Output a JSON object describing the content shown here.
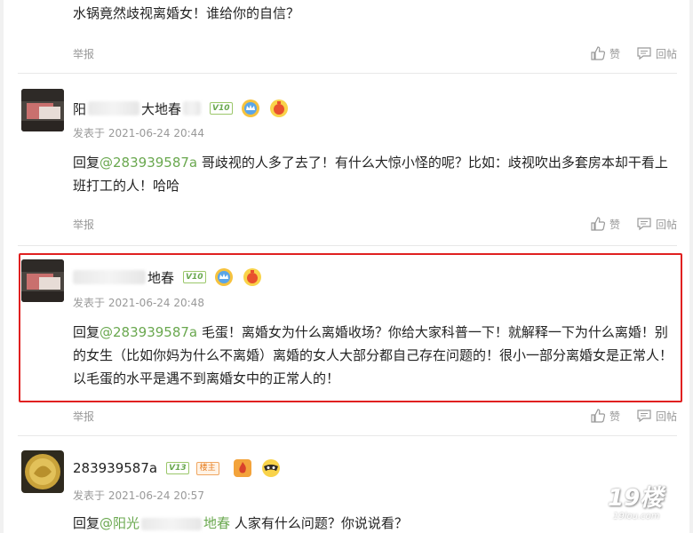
{
  "thread": {
    "top_comment": {
      "text": "水锅竟然歧视离婚女！谁给你的自信？",
      "actions": {
        "report": "举报",
        "like": "赞",
        "reply": "回帖"
      }
    },
    "posts": [
      {
        "username_visible": "阳",
        "username_tail": "大地春",
        "level": "10",
        "time": "发表于 2021-06-24 20:44",
        "reply_prefix": "回复",
        "reply_to": "@283939587a",
        "text": " 哥歧视的人多了去了！有什么大惊小怪的呢？比如：歧视吹出多套房本却干看上班打工的人！哈哈",
        "actions": {
          "report": "举报",
          "like": "赞",
          "reply": "回帖"
        }
      },
      {
        "username_visible": "",
        "username_tail": "地春",
        "level": "10",
        "time": "发表于 2021-06-24 20:48",
        "reply_prefix": "回复",
        "reply_to": "@283939587a",
        "text": " 毛蛋！离婚女为什么离婚收场？你给大家科普一下！就解释一下为什么离婚！别的女生（比如你妈为什么不离婚）离婚的女人大部分都自己存在问题的！很小一部分离婚女是正常人！以毛蛋的水平是遇不到离婚女中的正常人的！",
        "actions": {
          "report": "举报",
          "like": "赞",
          "reply": "回帖"
        }
      },
      {
        "username": "283939587a",
        "level": "13",
        "owner_badge": "楼主",
        "time": "发表于 2021-06-24 20:57",
        "reply_prefix": "回复",
        "reply_to_a": "@阳光",
        "reply_to_b": "地春",
        "text": " 人家有什么问题？你说说看？"
      }
    ]
  },
  "watermark": {
    "main": "19楼",
    "sub": "19lou.com"
  },
  "colors": {
    "link": "#6aa84f",
    "highlight": "#e02020",
    "muted": "#999999"
  }
}
